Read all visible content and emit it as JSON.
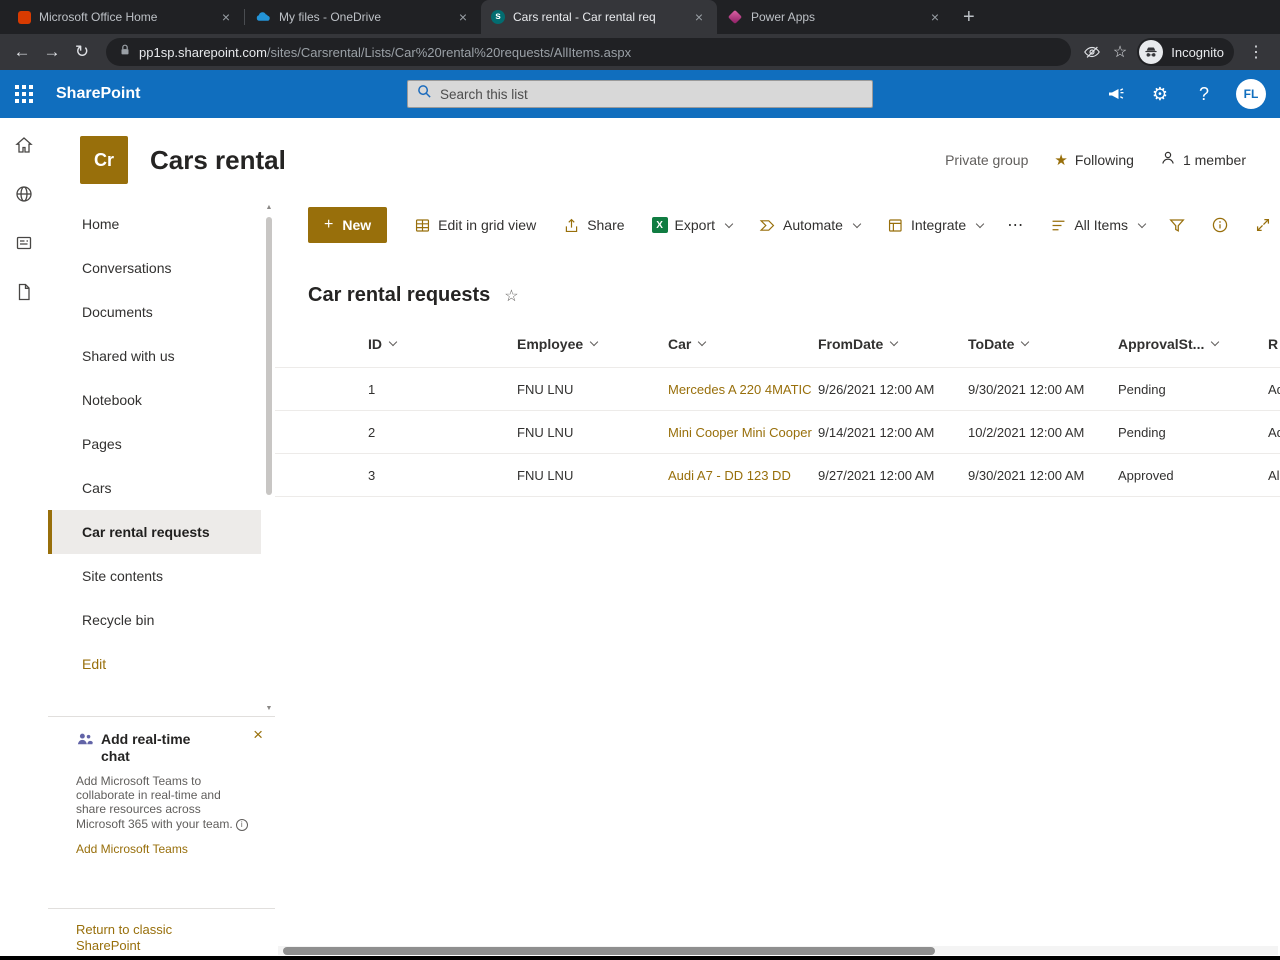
{
  "icons": {
    "back": "←",
    "forward": "→",
    "reload": "↻",
    "menu_dots": "⋮",
    "bookmark_star": "☆",
    "new_tab_plus": "+",
    "close_x": "×",
    "gear": "⚙",
    "help": "?",
    "ellipsis": "⋯",
    "plus": "+",
    "following_star": "★",
    "title_star": "☆",
    "info_i": "i",
    "scroll_up": "▲",
    "scroll_down": "▼"
  },
  "browser": {
    "tabs": [
      {
        "title": "Microsoft Office Home"
      },
      {
        "title": "My files - OneDrive"
      },
      {
        "title": "Cars rental - Car rental req"
      },
      {
        "title": "Power Apps"
      }
    ],
    "url_host": "pp1sp.sharepoint.com",
    "url_path": "/sites/Carsrental/Lists/Car%20rental%20requests/AllItems.aspx",
    "incognito_label": "Incognito",
    "sharepoint_favicon_letter": "s"
  },
  "suitebar": {
    "app_name": "SharePoint",
    "search_placeholder": "Search this list",
    "avatar_initials": "FL"
  },
  "site_header": {
    "logo_text": "Cr",
    "title": "Cars rental",
    "privacy_label": "Private group",
    "following_label": "Following",
    "members_label": "1 member"
  },
  "nav": {
    "items": [
      {
        "label": "Home"
      },
      {
        "label": "Conversations"
      },
      {
        "label": "Documents"
      },
      {
        "label": "Shared with us"
      },
      {
        "label": "Notebook"
      },
      {
        "label": "Pages"
      },
      {
        "label": "Cars"
      },
      {
        "label": "Car rental requests"
      },
      {
        "label": "Site contents"
      },
      {
        "label": "Recycle bin"
      }
    ],
    "selected_item": "Car rental requests",
    "edit_label": "Edit"
  },
  "teams_promo": {
    "title": "Add real-time chat",
    "body": "Add Microsoft Teams to collaborate in real-time and share resources across Microsoft 365 with your team.",
    "link_label": "Add Microsoft Teams"
  },
  "footer": {
    "classic_link": "Return to classic SharePoint"
  },
  "command_bar": {
    "new_label": "New",
    "edit_grid_label": "Edit in grid view",
    "share_label": "Share",
    "export_label": "Export",
    "export_badge": "X",
    "automate_label": "Automate",
    "integrate_label": "Integrate",
    "view_label": "All Items"
  },
  "list": {
    "title": "Car rental requests",
    "columns": [
      "ID",
      "Employee",
      "Car",
      "FromDate",
      "ToDate",
      "ApprovalSt...",
      "R"
    ],
    "rows": [
      {
        "id": "1",
        "employee": "FNU LNU",
        "car": "Mercedes A 220 4MATIC",
        "from_date": "9/26/2021 12:00 AM",
        "to_date": "9/30/2021 12:00 AM",
        "approval_status": "Pending",
        "r": "Ad"
      },
      {
        "id": "2",
        "employee": "FNU LNU",
        "car": "Mini Cooper Mini Cooper",
        "from_date": "9/14/2021 12:00 AM",
        "to_date": "10/2/2021 12:00 AM",
        "approval_status": "Pending",
        "r": "Ad"
      },
      {
        "id": "3",
        "employee": "FNU LNU",
        "car": "Audi A7 - DD 123 DD",
        "from_date": "9/27/2021 12:00 AM",
        "to_date": "9/30/2021 12:00 AM",
        "approval_status": "Approved",
        "r": "Al"
      }
    ]
  },
  "colors": {
    "theme_gold": "#986f0b",
    "suite_blue": "#106ebe",
    "excel_green": "#107c41"
  }
}
